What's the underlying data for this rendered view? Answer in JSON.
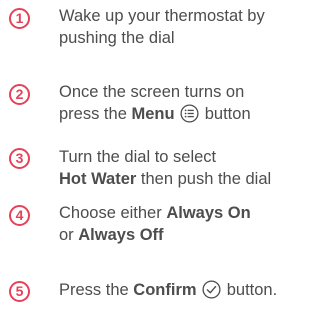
{
  "steps": [
    {
      "number": "1",
      "line1": "Wake up your thermostat by",
      "line2": "pushing the dial"
    },
    {
      "number": "2",
      "line1": "Once the screen turns on",
      "line2_pre": "press the ",
      "line2_bold": "Menu",
      "line2_icon": "menu-list-icon",
      "line2_post": " button"
    },
    {
      "number": "3",
      "line1": "Turn the dial to select",
      "line2_bold": "Hot Water",
      "line2_post": " then push the dial"
    },
    {
      "number": "4",
      "line1_pre": "Choose either ",
      "line1_bold": "Always On",
      "line2_pre": "or ",
      "line2_bold": "Always Off"
    },
    {
      "number": "5",
      "line1_pre": "Press the ",
      "line1_bold": "Confirm",
      "line1_icon": "checkmark-circle-icon",
      "line1_post": " button."
    }
  ],
  "colors": {
    "accent": "#e5425a",
    "text": "#4d4d4f"
  }
}
